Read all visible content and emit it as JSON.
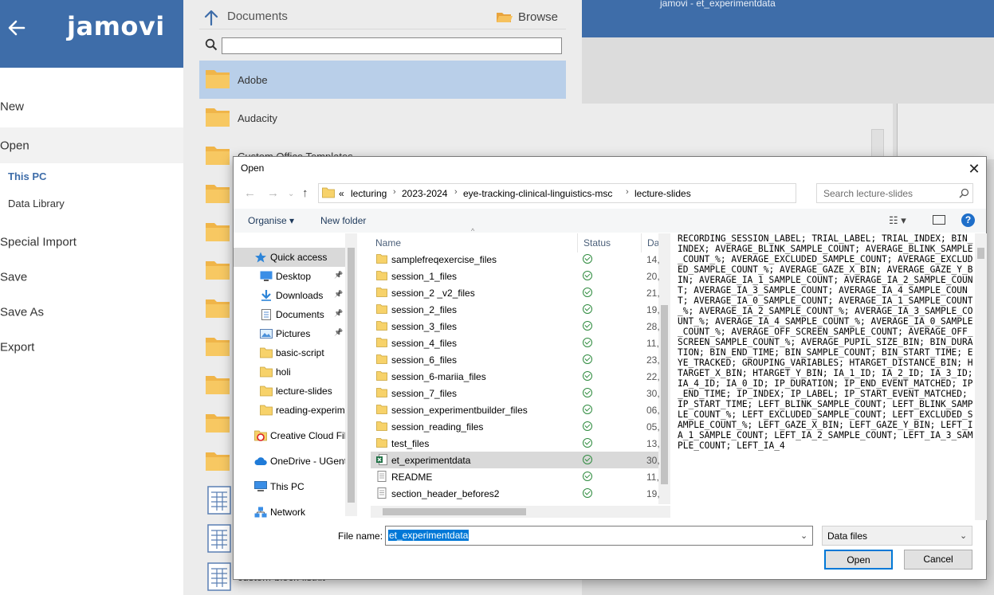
{
  "app": {
    "logo": "jamovi",
    "window_title": "jamovi - et_experimentdata",
    "accent": "#3e6da9"
  },
  "menu": {
    "back_icon": "arrow-left-icon",
    "items": [
      {
        "label": "New"
      },
      {
        "label": "Open"
      },
      {
        "label": "Special Import"
      },
      {
        "label": "Save"
      },
      {
        "label": "Save As"
      },
      {
        "label": "Export"
      }
    ],
    "open_sub": [
      {
        "label": "This PC"
      },
      {
        "label": "Data Library"
      }
    ]
  },
  "browser": {
    "path_label": "Documents",
    "browse_label": "Browse",
    "search_value": "",
    "folders": [
      {
        "label": "Adobe"
      },
      {
        "label": "Audacity"
      },
      {
        "label": "Custom Office Templates"
      }
    ],
    "bottom_label": "custom-block-listkit"
  },
  "dialog": {
    "title": "Open",
    "breadcrumb": [
      "«",
      "lecturing",
      "2023-2024",
      "eye-tracking-clinical-linguistics-msc",
      "lecture-slides"
    ],
    "search_placeholder": "Search lecture-slides",
    "organise": "Organise ▾",
    "new_folder": "New folder",
    "nav": [
      {
        "label": "Quick access",
        "icon": "star-icon",
        "active": true
      },
      {
        "label": "Desktop",
        "icon": "desktop-icon",
        "pinned": true
      },
      {
        "label": "Downloads",
        "icon": "download-icon",
        "pinned": true
      },
      {
        "label": "Documents",
        "icon": "document-icon",
        "pinned": true
      },
      {
        "label": "Pictures",
        "icon": "picture-icon",
        "pinned": true
      },
      {
        "label": "basic-script",
        "icon": "folder-icon"
      },
      {
        "label": "holi",
        "icon": "folder-icon"
      },
      {
        "label": "lecture-slides",
        "icon": "folder-icon"
      },
      {
        "label": "reading-experim",
        "icon": "folder-icon"
      },
      {
        "label": "Creative Cloud Fil",
        "icon": "creative-cloud-icon"
      },
      {
        "label": "OneDrive - UGent",
        "icon": "cloud-icon"
      },
      {
        "label": "This PC",
        "icon": "computer-icon"
      },
      {
        "label": "Network",
        "icon": "network-icon"
      }
    ],
    "columns": {
      "name": "Name",
      "status": "Status",
      "date": "Da"
    },
    "files": [
      {
        "name": "samplefreqexercise_files",
        "type": "folder",
        "date": "14,"
      },
      {
        "name": "session_1_files",
        "type": "folder",
        "date": "20,"
      },
      {
        "name": "session_2 _v2_files",
        "type": "folder",
        "date": "21,"
      },
      {
        "name": "session_2_files",
        "type": "folder",
        "date": "19,"
      },
      {
        "name": "session_3_files",
        "type": "folder",
        "date": "28,"
      },
      {
        "name": "session_4_files",
        "type": "folder",
        "date": "11,"
      },
      {
        "name": "session_6_files",
        "type": "folder",
        "date": "23,"
      },
      {
        "name": "session_6-mariia_files",
        "type": "folder",
        "date": "22,"
      },
      {
        "name": "session_7_files",
        "type": "folder",
        "date": "30,"
      },
      {
        "name": "session_experimentbuilder_files",
        "type": "folder",
        "date": "06,"
      },
      {
        "name": "session_reading_files",
        "type": "folder",
        "date": "05,"
      },
      {
        "name": "test_files",
        "type": "folder",
        "date": "13,"
      },
      {
        "name": "et_experimentdata",
        "type": "excel",
        "date": "30,",
        "selected": true
      },
      {
        "name": "README",
        "type": "text",
        "date": "11,"
      },
      {
        "name": "section_header_befores2",
        "type": "text",
        "date": "19,"
      }
    ],
    "preview_text": "RECORDING_SESSION_LABEL; TRIAL_LABEL; TRIAL_INDEX; BIN_INDEX; AVERAGE_BLINK_SAMPLE_COUNT; AVERAGE_BLINK_SAMPLE_COUNT_%; AVERAGE_EXCLUDED_SAMPLE_COUNT; AVERAGE_EXCLUDED_SAMPLE_COUNT_%; AVERAGE_GAZE_X_BIN; AVERAGE_GAZE_Y_BIN; AVERAGE_IA_1_SAMPLE_COUNT; AVERAGE_IA_2_SAMPLE_COUNT; AVERAGE_IA_3_SAMPLE_COUNT; AVERAGE_IA_4_SAMPLE_COUNT; AVERAGE_IA_0_SAMPLE_COUNT; AVERAGE_IA_1_SAMPLE_COUNT_%; AVERAGE_IA_2_SAMPLE_COUNT_%; AVERAGE_IA_3_SAMPLE_COUNT_%; AVERAGE_IA_4_SAMPLE_COUNT_%; AVERAGE_IA_0_SAMPLE_COUNT_%; AVERAGE_OFF_SCREEN_SAMPLE_COUNT; AVERAGE_OFF_SCREEN_SAMPLE_COUNT_%; AVERAGE_PUPIL_SIZE_BIN; BIN_DURATION; BIN_END_TIME; BIN_SAMPLE_COUNT; BIN_START_TIME; EYE_TRACKED; GROUPING_VARIABLES; HTARGET_DISTANCE_BIN; HTARGET_X_BIN; HTARGET_Y_BIN; IA_1_ID; IA_2_ID; IA_3_ID; IA_4_ID; IA_0_ID; IP_DURATION; IP_END_EVENT_MATCHED; IP_END_TIME; IP_INDEX; IP_LABEL; IP_START_EVENT_MATCHED; IP_START_TIME; LEFT_BLINK_SAMPLE_COUNT; LEFT_BLINK_SAMPLE_COUNT_%; LEFT_EXCLUDED_SAMPLE_COUNT; LEFT_EXCLUDED_SAMPLE_COUNT_%; LEFT_GAZE_X_BIN; LEFT_GAZE_Y_BIN; LEFT_IA_1_SAMPLE_COUNT; LEFT_IA_2_SAMPLE_COUNT; LEFT_IA_3_SAMPLE_COUNT; LEFT_IA_4",
    "filename_label": "File name:",
    "filename_value": "et_experimentdata",
    "filetype_value": "Data files",
    "open_label": "Open",
    "cancel_label": "Cancel",
    "close_symbol": "✕"
  }
}
